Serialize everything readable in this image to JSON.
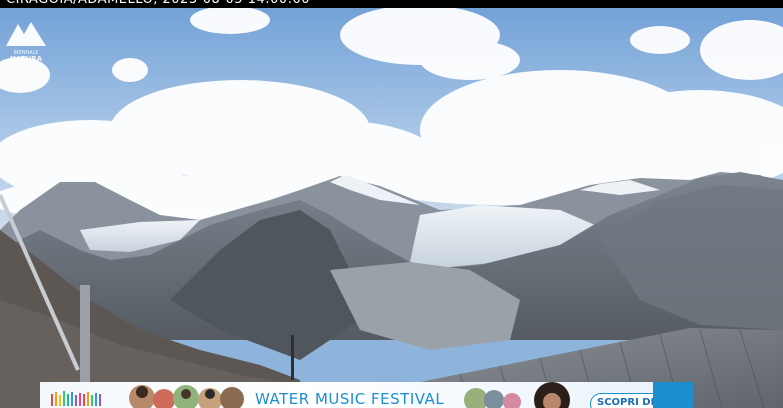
{
  "webcam": {
    "caption": "CIRAGOIA/ADAMELLO, 2023-08-05 14:00:00"
  },
  "logo": {
    "line1": "BIENNALE",
    "line2": "NATURA"
  },
  "banner": {
    "title": "WATER MUSIC FESTIVAL",
    "cta_label": "SCOPRI DI PIÙ",
    "accent_color": "#1b8fd0"
  }
}
